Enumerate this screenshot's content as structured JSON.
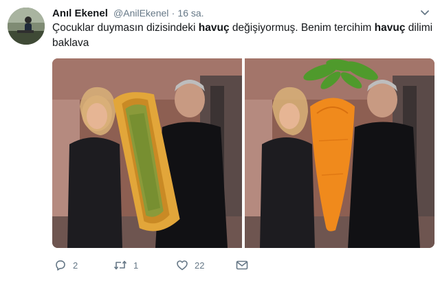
{
  "tweet": {
    "author_name": "Anıl Ekenel",
    "handle": "@AnilEkenel",
    "separator": "·",
    "time": "16 sa.",
    "text_parts": {
      "p1": "Çocuklar duymasın dizisindeki ",
      "b1": "havuç",
      "p2": " değişiyormuş. Benim tercihim ",
      "b2": "havuç",
      "p3": " dilimi baklava"
    },
    "actions": {
      "reply_count": "2",
      "retweet_count": "1",
      "like_count": "22"
    }
  },
  "icons": {
    "caret": "chevron-down-icon",
    "reply": "reply-icon",
    "retweet": "retweet-icon",
    "like": "heart-icon",
    "dm": "envelope-icon"
  },
  "colors": {
    "text": "#14171a",
    "secondary": "#657786"
  }
}
